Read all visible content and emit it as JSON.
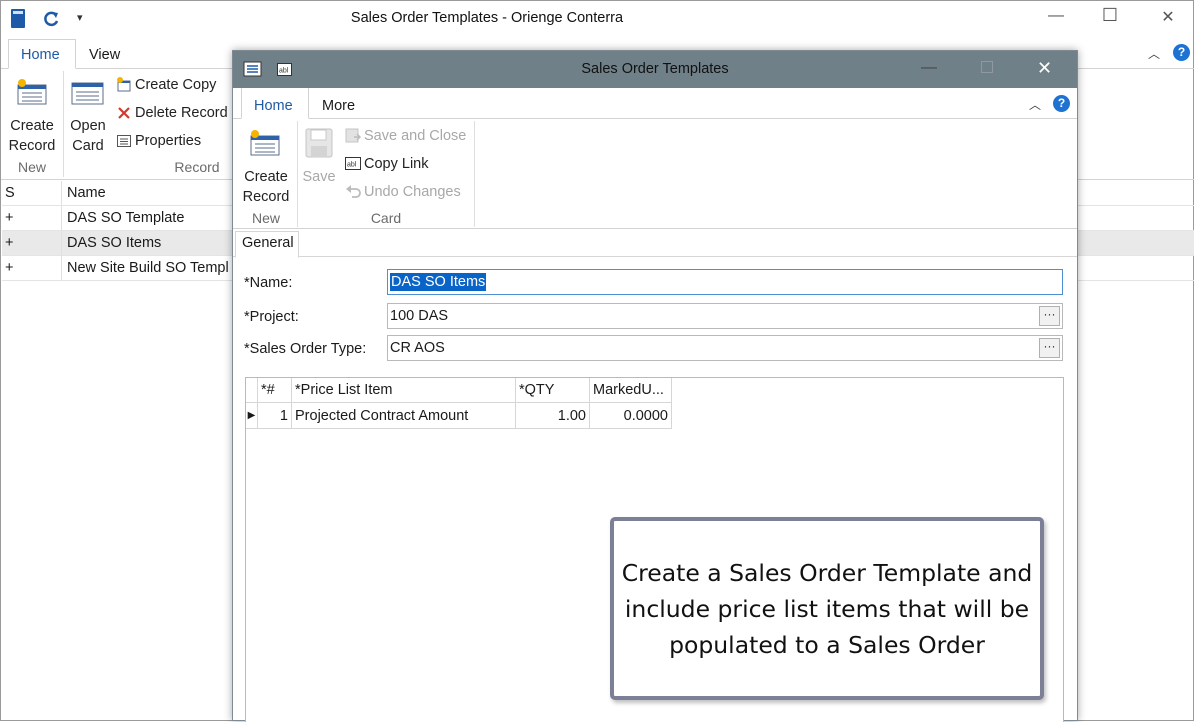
{
  "main_window": {
    "title": "Sales Order Templates - Orienge Conterra",
    "tabs": [
      "Home",
      "View"
    ],
    "ribbon": {
      "new_group": {
        "create_record": [
          "Create",
          "Record"
        ],
        "label": "New"
      },
      "record_group": {
        "open_card": [
          "Open",
          "Card"
        ],
        "create_copy": "Create Copy",
        "delete_record": "Delete Record",
        "properties": "Properties",
        "label": "Record"
      }
    },
    "list": {
      "columns": [
        "S",
        "Name"
      ],
      "rows": [
        {
          "s": "+",
          "name": "DAS SO Template"
        },
        {
          "s": "+",
          "name": "DAS SO Items"
        },
        {
          "s": "+",
          "name": "New Site Build SO Templ"
        }
      ]
    },
    "controls": {
      "minimize": "—",
      "maximize": "☐",
      "close": "✕"
    }
  },
  "dialog": {
    "title": "Sales Order Templates",
    "tabs": [
      "Home",
      "More"
    ],
    "ribbon": {
      "new_group": {
        "create_record": [
          "Create",
          "Record"
        ],
        "label": "New"
      },
      "save": "Save",
      "card_group": {
        "save_and_close": "Save and Close",
        "copy_link": "Copy Link",
        "undo_changes": "Undo Changes",
        "label": "Card"
      }
    },
    "section_tab": "General",
    "form": {
      "name_label": "*Name:",
      "name_value": "DAS SO Items",
      "project_label": "*Project:",
      "project_value": "100 DAS",
      "sales_order_type_label": "*Sales Order Type:",
      "sales_order_type_value": "CR AOS",
      "ellipsis": "···"
    },
    "grid": {
      "columns": [
        "*#",
        "*Price List Item",
        "*QTY",
        "MarkedU..."
      ],
      "rows": [
        {
          "num": "1",
          "item": "Projected Contract Amount",
          "qty": "1.00",
          "marked": "0.0000"
        }
      ]
    }
  },
  "callout": {
    "text": "Create a Sales Order Template and include price list items that will be populated to a Sales Order"
  },
  "colors": {
    "accent": "#1e5aa8",
    "dialog_titlebar": "#6f8088",
    "selection": "#0a64c8"
  }
}
